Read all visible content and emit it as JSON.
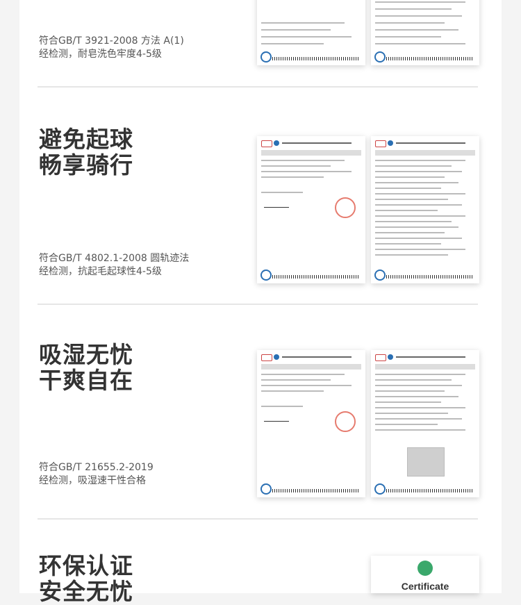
{
  "sections": [
    {
      "title": "",
      "desc": "符合GB/T 3921-2008 方法 A(1)\n经检测，耐皂洗色牢度4-5级"
    },
    {
      "title": "避免起球\n畅享骑行",
      "desc": "符合GB/T 4802.1-2008 圆轨迹法\n经检测，抗起毛起球性4-5级"
    },
    {
      "title": "吸湿无忧\n干爽自在",
      "desc": "符合GB/T 21655.2-2019\n经检测，吸湿速干性合格"
    },
    {
      "title": "环保认证\n安全无忧",
      "desc": ""
    }
  ],
  "certificate": {
    "label": "Certificate",
    "badge_icon": "oeko-tex-icon"
  },
  "colors": {
    "title": "#333333",
    "desc": "#555555",
    "divider": "#e6e6e6",
    "stamp": "#e05a4a",
    "accent": "#2a6fb3"
  }
}
